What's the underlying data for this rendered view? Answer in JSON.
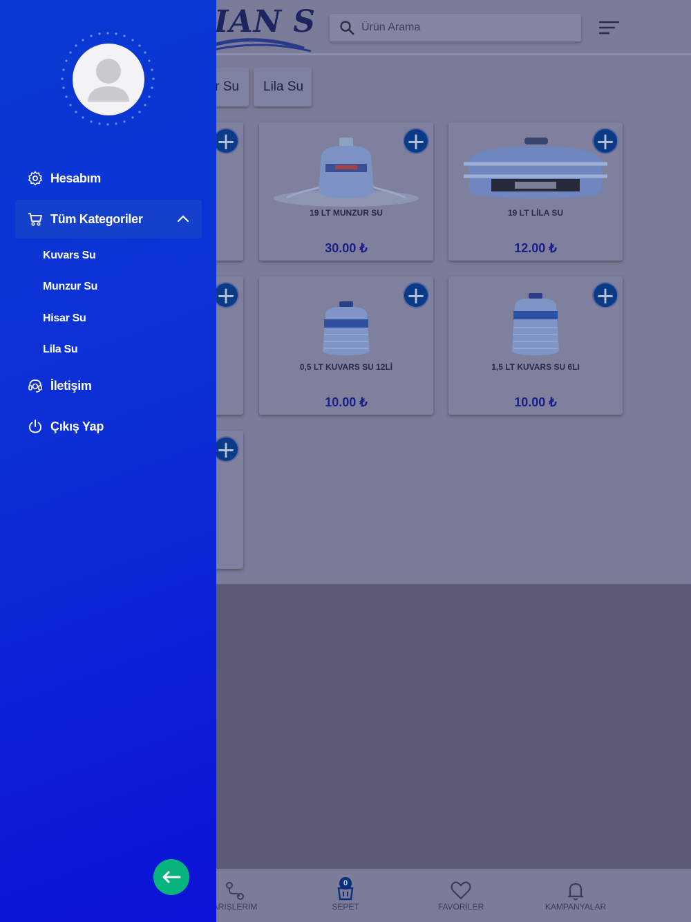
{
  "header": {
    "logo_text": "IAN SU",
    "search_placeholder": "Ürün Arama"
  },
  "categories": [
    {
      "label": "r Su"
    },
    {
      "label": "Lila Su"
    }
  ],
  "products": [
    {
      "name": "19 LT MUNZUR SU",
      "price": "30.00 ₺"
    },
    {
      "name": "19 LT LİLA SU",
      "price": "12.00 ₺"
    },
    {
      "name": "0,5 LT KUVARS SU 12Lİ",
      "price": "10.00 ₺"
    },
    {
      "name": "1,5 LT KUVARS SU 6LI",
      "price": "10.00 ₺"
    }
  ],
  "bottom_nav": {
    "orders": "ARIŞLERIM",
    "cart": "SEPET",
    "cart_count": "0",
    "favorites": "FAVORİLER",
    "campaigns": "KAMPANYALAR"
  },
  "drawer": {
    "account": "Hesabım",
    "all_categories": "Tüm Kategoriler",
    "sub_categories": [
      "Kuvars Su",
      "Munzur Su",
      "Hisar Su",
      "Lila Su"
    ],
    "contact": "İletişim",
    "logout": "Çıkış Yap"
  },
  "colors": {
    "drawer_gradient_start": "#0a3ad2",
    "drawer_gradient_end": "#0c12d6",
    "back_button": "#07b47e",
    "price": "#1a1f86",
    "add_button": "#0b3a86"
  },
  "icons": {
    "account": "gear-icon",
    "categories": "cart-icon",
    "contact": "headset-icon",
    "logout": "power-icon",
    "back": "arrow-left-icon"
  }
}
